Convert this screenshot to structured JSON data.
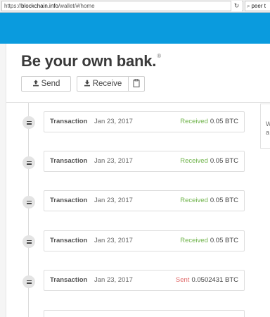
{
  "browser": {
    "url_prefix": "https://",
    "url_domain": "blockchain.info",
    "url_path": "/wallet/#/home",
    "search_text": "peer t"
  },
  "wallet": {
    "headline": "Be your own bank.",
    "registered_mark": "®",
    "send_label": "Send",
    "receive_label": "Receive"
  },
  "transactions": [
    {
      "label": "Transaction",
      "date": "Jan 23, 2017",
      "status": "Received",
      "amount": "0.05 BTC"
    },
    {
      "label": "Transaction",
      "date": "Jan 23, 2017",
      "status": "Received",
      "amount": "0.05 BTC"
    },
    {
      "label": "Transaction",
      "date": "Jan 23, 2017",
      "status": "Received",
      "amount": "0.05 BTC"
    },
    {
      "label": "Transaction",
      "date": "Jan 23, 2017",
      "status": "Received",
      "amount": "0.05 BTC"
    },
    {
      "label": "Transaction",
      "date": "Jan 23, 2017",
      "status": "Sent",
      "amount": "0.0502431 BTC"
    }
  ],
  "side_panel": {
    "line1": "W",
    "line2": "a"
  },
  "colors": {
    "header": "#0a9bde",
    "received": "#6fb34a",
    "sent": "#e06a6a"
  }
}
